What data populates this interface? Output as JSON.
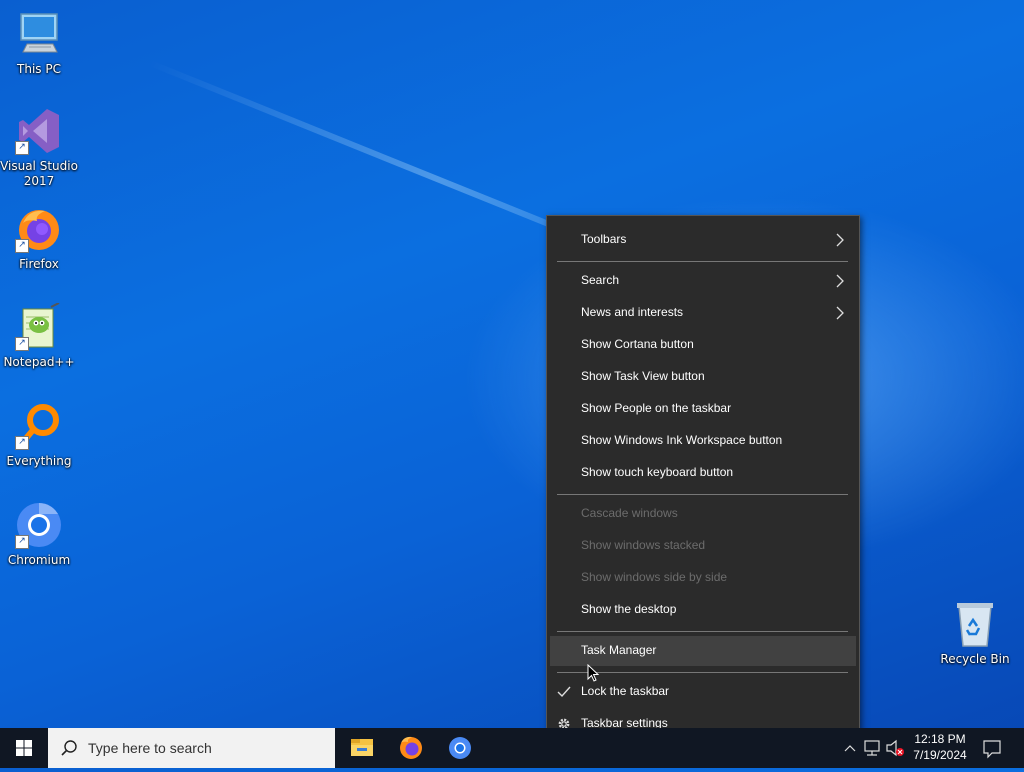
{
  "desktop": {
    "icons": [
      {
        "label": "This PC",
        "icon": "this-pc-icon"
      },
      {
        "label": "Visual Studio 2017",
        "icon": "visual-studio-icon"
      },
      {
        "label": "Firefox",
        "icon": "firefox-icon"
      },
      {
        "label": "Notepad++",
        "icon": "notepad-plus-plus-icon"
      },
      {
        "label": "Everything",
        "icon": "everything-icon"
      },
      {
        "label": "Chromium",
        "icon": "chromium-icon"
      }
    ],
    "recycle_bin": {
      "label": "Recycle Bin",
      "icon": "recycle-bin-icon"
    }
  },
  "context_menu": {
    "items": [
      {
        "label": "Toolbars",
        "submenu": true
      },
      {
        "label": "Search",
        "submenu": true
      },
      {
        "label": "News and interests",
        "submenu": true
      },
      {
        "label": "Show Cortana button"
      },
      {
        "label": "Show Task View button"
      },
      {
        "label": "Show People on the taskbar"
      },
      {
        "label": "Show Windows Ink Workspace button"
      },
      {
        "label": "Show touch keyboard button"
      },
      {
        "label": "Cascade windows",
        "disabled": true
      },
      {
        "label": "Show windows stacked",
        "disabled": true
      },
      {
        "label": "Show windows side by side",
        "disabled": true
      },
      {
        "label": "Show the desktop"
      },
      {
        "label": "Task Manager",
        "hovered": true
      },
      {
        "label": "Lock the taskbar",
        "checked": true
      },
      {
        "label": "Taskbar settings",
        "icon": "gear-icon"
      }
    ]
  },
  "taskbar": {
    "search_placeholder": "Type here to search",
    "apps": [
      "file-explorer-icon",
      "firefox-icon",
      "chromium-icon"
    ],
    "clock": {
      "time": "12:18 PM",
      "date": "7/19/2024"
    }
  },
  "colors": {
    "menu_bg": "#2b2b2b",
    "menu_hover": "#414141",
    "taskbar_bg": "#101723",
    "desktop_blue": "#0a6ad8"
  }
}
